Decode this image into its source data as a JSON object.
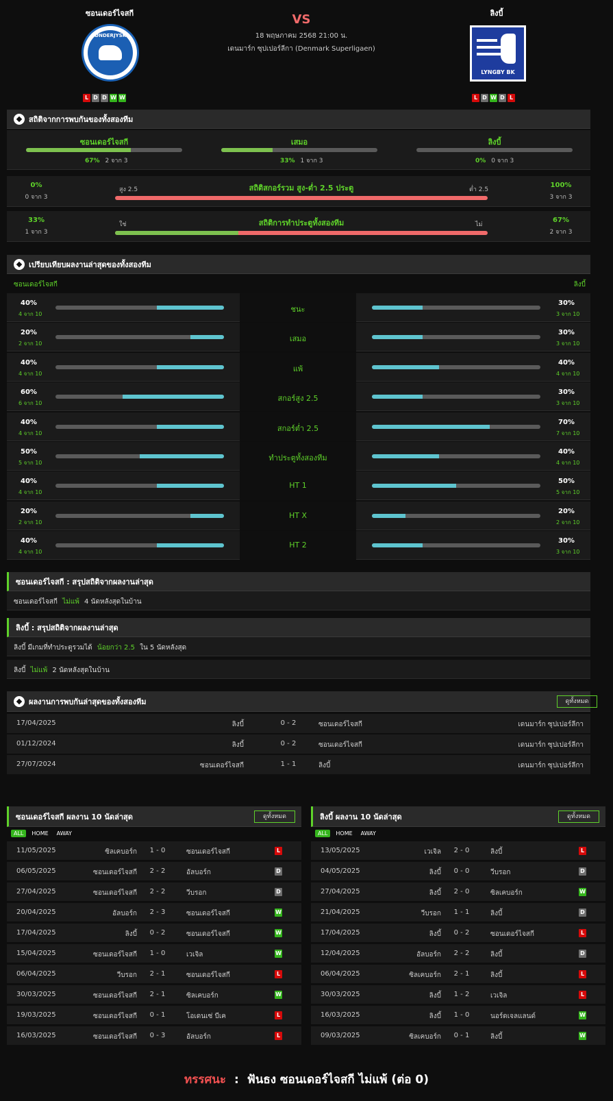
{
  "match": {
    "home": "ซอนเดอร์ไจสกี",
    "away": "ลิงบี้",
    "vs": "VS",
    "datetime": "18 พฤษภาคม 2568 21:00 น.",
    "league": "เดนมาร์ก ซุปเปอร์ลีกา (Denmark Superligaen)",
    "home_logo_text": "SØNDERJYSKE",
    "away_logo_text": "LYNGBY BK",
    "home_form": [
      "L",
      "D",
      "D",
      "W",
      "W"
    ],
    "away_form": [
      "L",
      "D",
      "W",
      "D",
      "L"
    ]
  },
  "h2h_stats": {
    "title": "สถิติจากการพบกันของทั้งสองทีม",
    "cols": [
      {
        "label": "ซอนเดอร์ไจสกี",
        "pct": "67%",
        "count": "2 จาก 3",
        "value": 67
      },
      {
        "label": "เสมอ",
        "pct": "33%",
        "count": "1 จาก 3",
        "value": 33
      },
      {
        "label": "ลิงบี้",
        "pct": "0%",
        "count": "0 จาก 3",
        "value": 0
      }
    ],
    "ou": {
      "title": "สถิติสกอร์รวม สูง-ต่ำ 2.5 ประตู",
      "left_label": "สูง 2.5",
      "right_label": "ต่ำ 2.5",
      "left_pct": "0%",
      "left_count": "0 จาก 3",
      "right_pct": "100%",
      "right_count": "3 จาก 3",
      "value": 0
    },
    "btts": {
      "title": "สถิติการทำประตูทั้งสองทีม",
      "left_label": "ใช่",
      "right_label": "ไม่",
      "left_pct": "33%",
      "left_count": "1 จาก 3",
      "right_pct": "67%",
      "right_count": "2 จาก 3",
      "value": 33
    }
  },
  "compare": {
    "title": "เปรียบเทียบผลงานล่าสุดของทั้งสองทีม",
    "home": "ซอนเดอร์ไจสกี",
    "away": "ลิงบี้",
    "rows": [
      {
        "label": "ชนะ",
        "hp": "40%",
        "hc": "4 จาก 10",
        "hv": 40,
        "ap": "30%",
        "ac": "3 จาก 10",
        "av": 30
      },
      {
        "label": "เสมอ",
        "hp": "20%",
        "hc": "2 จาก 10",
        "hv": 20,
        "ap": "30%",
        "ac": "3 จาก 10",
        "av": 30
      },
      {
        "label": "แพ้",
        "hp": "40%",
        "hc": "4 จาก 10",
        "hv": 40,
        "ap": "40%",
        "ac": "4 จาก 10",
        "av": 40
      },
      {
        "label": "สกอร์สูง 2.5",
        "hp": "60%",
        "hc": "6 จาก 10",
        "hv": 60,
        "ap": "30%",
        "ac": "3 จาก 10",
        "av": 30
      },
      {
        "label": "สกอร์ต่ำ 2.5",
        "hp": "40%",
        "hc": "4 จาก 10",
        "hv": 40,
        "ap": "70%",
        "ac": "7 จาก 10",
        "av": 70
      },
      {
        "label": "ทำประตูทั้งสองทีม",
        "hp": "50%",
        "hc": "5 จาก 10",
        "hv": 50,
        "ap": "40%",
        "ac": "4 จาก 10",
        "av": 40
      },
      {
        "label": "HT 1",
        "hp": "40%",
        "hc": "4 จาก 10",
        "hv": 40,
        "ap": "50%",
        "ac": "5 จาก 10",
        "av": 50
      },
      {
        "label": "HT X",
        "hp": "20%",
        "hc": "2 จาก 10",
        "hv": 20,
        "ap": "20%",
        "ac": "2 จาก 10",
        "av": 20
      },
      {
        "label": "HT 2",
        "hp": "40%",
        "hc": "4 จาก 10",
        "hv": 40,
        "ap": "30%",
        "ac": "3 จาก 10",
        "av": 30
      }
    ]
  },
  "summary_home": {
    "title": "ซอนเดอร์ไจสกี : สรุปสถิติจากผลงานล่าสุด",
    "line1": {
      "a": "ซอนเดอร์ไจสกี",
      "b": "ไม่แพ้",
      "c": "4 นัดหลังสุดในบ้าน"
    }
  },
  "summary_away": {
    "title": "ลิงบี้ : สรุปสถิติจากผลงานล่าสุด",
    "line1": {
      "a": "ลิงบี้ มีเกมที่ทำประตูรวมได้",
      "b": "น้อยกว่า 2.5",
      "c": "ใน 5 นัดหลังสุด"
    },
    "line2": {
      "a": "ลิงบี้",
      "b": "ไม่แพ้",
      "c": "2 นัดหลังสุดในบ้าน"
    }
  },
  "h2h_results": {
    "title": "ผลงานการพบกันล่าสุดของทั้งสองทีม",
    "view_all": "ดูทั้งหมด",
    "rows": [
      {
        "date": "17/04/2025",
        "home": "ลิงบี้",
        "score": "0 - 2",
        "away": "ซอนเดอร์ไจสกี",
        "league": "เดนมาร์ก ซุปเปอร์ลีกา"
      },
      {
        "date": "01/12/2024",
        "home": "ลิงบี้",
        "score": "0 - 2",
        "away": "ซอนเดอร์ไจสกี",
        "league": "เดนมาร์ก ซุปเปอร์ลีกา"
      },
      {
        "date": "27/07/2024",
        "home": "ซอนเดอร์ไจสกี",
        "score": "1 - 1",
        "away": "ลิงบี้",
        "league": "เดนมาร์ก ซุปเปอร์ลีกา"
      }
    ]
  },
  "last10_home": {
    "title": "ซอนเดอร์ไจสกี ผลงาน 10 นัดล่าสุด",
    "view_all": "ดูทั้งหมด",
    "filters": [
      "ALL",
      "HOME",
      "AWAY"
    ],
    "rows": [
      {
        "date": "11/05/2025",
        "home": "ซิลเคบอร์ก",
        "score": "1 - 0",
        "away": "ซอนเดอร์ไจสกี",
        "res": "L"
      },
      {
        "date": "06/05/2025",
        "home": "ซอนเดอร์ไจสกี",
        "score": "2 - 2",
        "away": "อัลบอร์ก",
        "res": "D"
      },
      {
        "date": "27/04/2025",
        "home": "ซอนเดอร์ไจสกี",
        "score": "2 - 2",
        "away": "วีบรอก",
        "res": "D"
      },
      {
        "date": "20/04/2025",
        "home": "อัลบอร์ก",
        "score": "2 - 3",
        "away": "ซอนเดอร์ไจสกี",
        "res": "W"
      },
      {
        "date": "17/04/2025",
        "home": "ลิงบี้",
        "score": "0 - 2",
        "away": "ซอนเดอร์ไจสกี",
        "res": "W"
      },
      {
        "date": "15/04/2025",
        "home": "ซอนเดอร์ไจสกี",
        "score": "1 - 0",
        "away": "เวเจิล",
        "res": "W"
      },
      {
        "date": "06/04/2025",
        "home": "วีบรอก",
        "score": "2 - 1",
        "away": "ซอนเดอร์ไจสกี",
        "res": "L"
      },
      {
        "date": "30/03/2025",
        "home": "ซอนเดอร์ไจสกี",
        "score": "2 - 1",
        "away": "ซิลเคบอร์ก",
        "res": "W"
      },
      {
        "date": "19/03/2025",
        "home": "ซอนเดอร์ไจสกี",
        "score": "0 - 1",
        "away": "โอเดนเซ่ บีเค",
        "res": "L"
      },
      {
        "date": "16/03/2025",
        "home": "ซอนเดอร์ไจสกี",
        "score": "0 - 3",
        "away": "อัลบอร์ก",
        "res": "L"
      }
    ]
  },
  "last10_away": {
    "title": "ลิงบี้ ผลงาน 10 นัดล่าสุด",
    "view_all": "ดูทั้งหมด",
    "filters": [
      "ALL",
      "HOME",
      "AWAY"
    ],
    "rows": [
      {
        "date": "13/05/2025",
        "home": "เวเจิล",
        "score": "2 - 0",
        "away": "ลิงบี้",
        "res": "L"
      },
      {
        "date": "04/05/2025",
        "home": "ลิงบี้",
        "score": "0 - 0",
        "away": "วีบรอก",
        "res": "D"
      },
      {
        "date": "27/04/2025",
        "home": "ลิงบี้",
        "score": "2 - 0",
        "away": "ซิลเคบอร์ก",
        "res": "W"
      },
      {
        "date": "21/04/2025",
        "home": "วีบรอก",
        "score": "1 - 1",
        "away": "ลิงบี้",
        "res": "D"
      },
      {
        "date": "17/04/2025",
        "home": "ลิงบี้",
        "score": "0 - 2",
        "away": "ซอนเดอร์ไจสกี",
        "res": "L"
      },
      {
        "date": "12/04/2025",
        "home": "อัลบอร์ก",
        "score": "2 - 2",
        "away": "ลิงบี้",
        "res": "D"
      },
      {
        "date": "06/04/2025",
        "home": "ซิลเคบอร์ก",
        "score": "2 - 1",
        "away": "ลิงบี้",
        "res": "L"
      },
      {
        "date": "30/03/2025",
        "home": "ลิงบี้",
        "score": "1 - 2",
        "away": "เวเจิล",
        "res": "L"
      },
      {
        "date": "16/03/2025",
        "home": "ลิงบี้",
        "score": "1 - 0",
        "away": "นอร์ดเจลแลนด์",
        "res": "W"
      },
      {
        "date": "09/03/2025",
        "home": "ซิลเคบอร์ก",
        "score": "0 - 1",
        "away": "ลิงบี้",
        "res": "W"
      }
    ]
  },
  "prediction": {
    "label": "ทรรศนะ",
    "sep": ":",
    "text": "ฟันธง ซอนเดอร์ไจสกี ไม่แพ้ (ต่อ 0)"
  },
  "colors": {
    "accent": "#5fd32a",
    "red": "#f06a6a",
    "teal": "#5ec4cf",
    "win": "#35b51d",
    "loss": "#d60a0a",
    "draw": "#6e6e6e"
  }
}
